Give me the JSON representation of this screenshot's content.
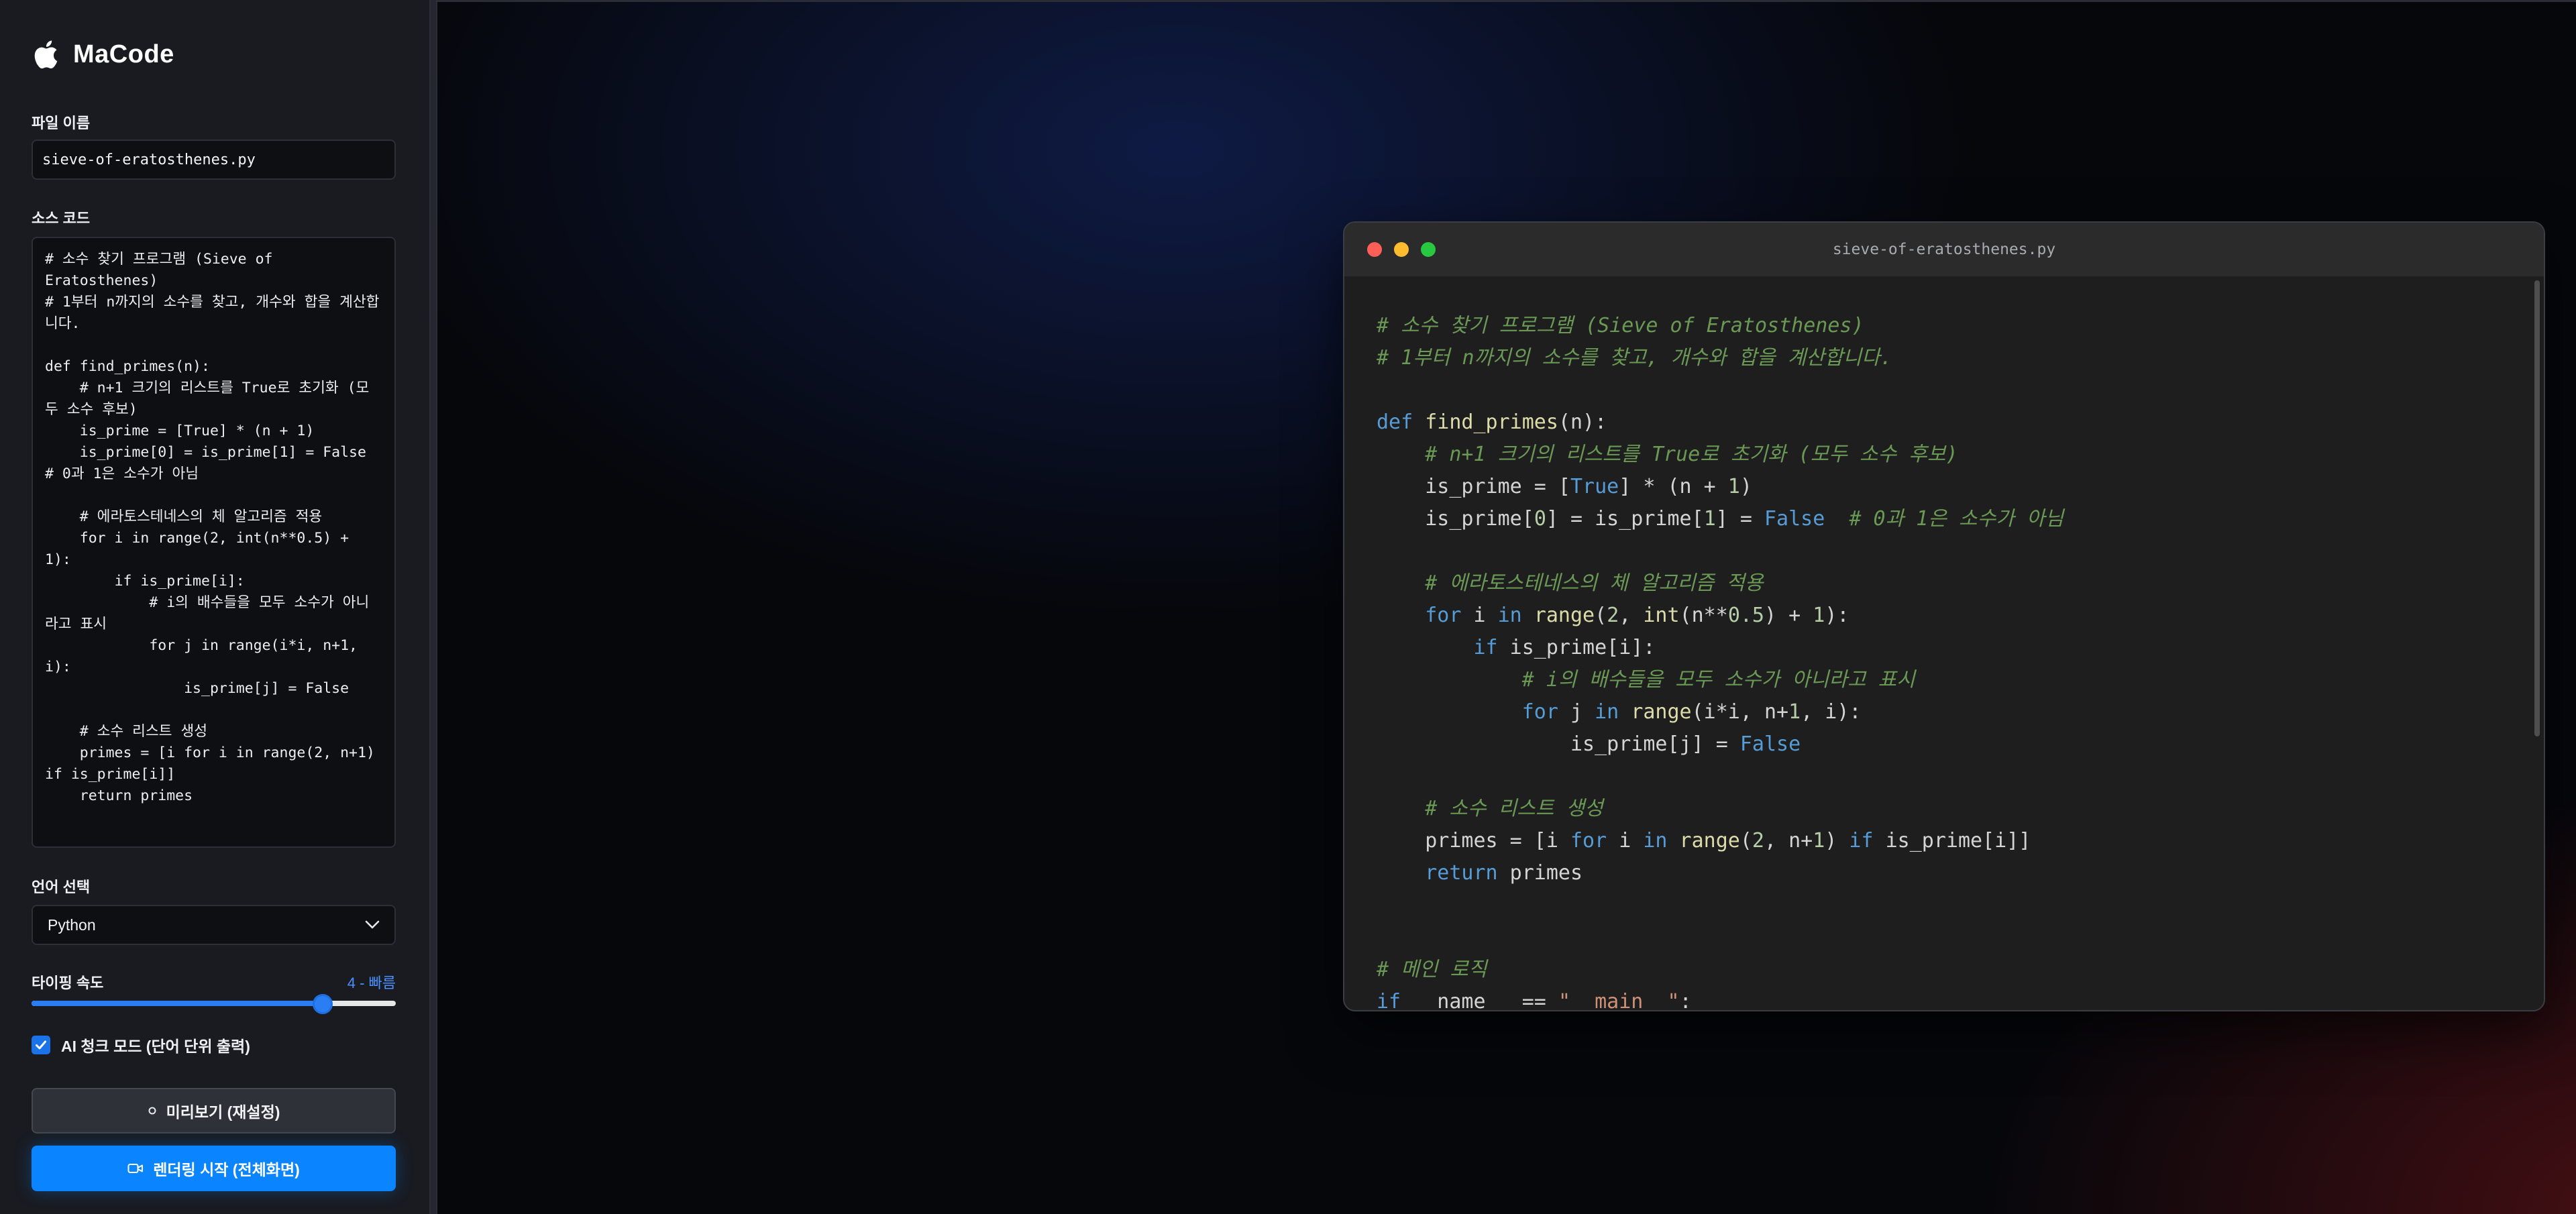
{
  "app": {
    "name": "MaCode"
  },
  "sidebar": {
    "filename_label": "파일 이름",
    "filename_value": "sieve-of-eratosthenes.py",
    "source_label": "소스 코드",
    "source_code": "# 소수 찾기 프로그램 (Sieve of Eratosthenes)\n# 1부터 n까지의 소수를 찾고, 개수와 합을 계산합니다.\n\ndef find_primes(n):\n    # n+1 크기의 리스트를 True로 초기화 (모두 소수 후보)\n    is_prime = [True] * (n + 1)\n    is_prime[0] = is_prime[1] = False  # 0과 1은 소수가 아님\n\n    # 에라토스테네스의 체 알고리즘 적용\n    for i in range(2, int(n**0.5) + 1):\n        if is_prime[i]:\n            # i의 배수들을 모두 소수가 아니라고 표시\n            for j in range(i*i, n+1, i):\n                is_prime[j] = False\n\n    # 소수 리스트 생성\n    primes = [i for i in range(2, n+1) if is_prime[i]]\n    return primes",
    "language_label": "언어 선택",
    "language_value": "Python",
    "speed_label": "타이핑 속도",
    "speed_value_text": "4 - 빠름",
    "speed_level": 4,
    "speed_max": 5,
    "ai_chunk_label": "AI 청크 모드 (단어 단위 출력)",
    "ai_chunk_checked": true,
    "preview_button": "미리보기 (재설정)",
    "render_button": "렌더링 시작 (전체화면)"
  },
  "editor": {
    "window_title": "sieve-of-eratosthenes.py"
  },
  "colors": {
    "accent": "#0a84ff",
    "sidebar_bg": "#191b21",
    "editor_bg": "#1e1e1e",
    "comment": "#6a9955",
    "keyword": "#569cd6",
    "function": "#dcdcaa"
  },
  "icons": {
    "brand": "apple-logo-icon",
    "language_dropdown": "chevron-down-icon",
    "preview_button": "circle-icon",
    "render_button": "video-camera-icon",
    "checkbox": "checkmark-icon"
  }
}
